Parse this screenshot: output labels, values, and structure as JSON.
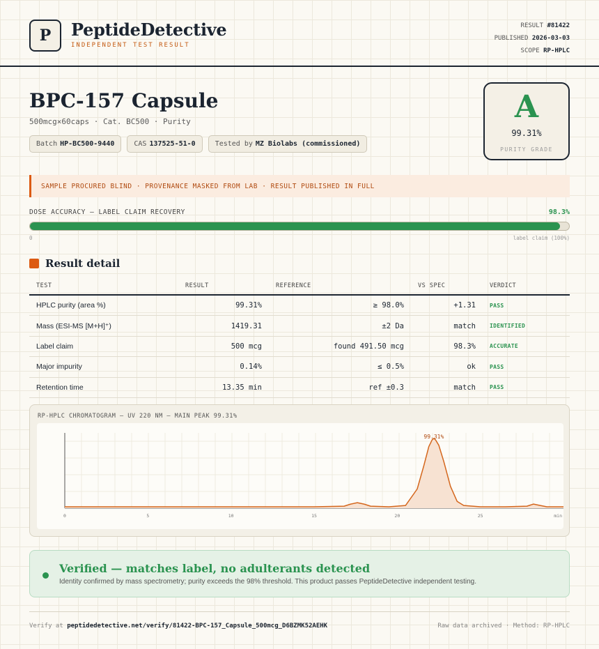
{
  "header": {
    "logo_letter": "P",
    "brand": "PeptideDetective",
    "tagline": "INDEPENDENT TEST RESULT",
    "result_label": "RESULT",
    "result_value": "#81422",
    "published_label": "PUBLISHED",
    "published_value": "2026-03-03",
    "scope_label": "SCOPE",
    "scope_value": "RP-HPLC"
  },
  "product": {
    "title": "BPC-157 Capsule",
    "subtitle": "500mcg×60caps · Cat. BC500 · Purity",
    "chips": [
      {
        "label": "Batch",
        "value": "HP-BC500-9440"
      },
      {
        "label": "CAS",
        "value": "137525-51-0"
      },
      {
        "label": "Tested by",
        "value": "MZ Biolabs (commissioned)"
      }
    ]
  },
  "grade": {
    "letter": "A",
    "percent": "99.31%",
    "label": "PURITY GRADE",
    "color": "#2b9350"
  },
  "notice": "SAMPLE PROCURED BLIND · PROVENANCE MASKED FROM LAB · RESULT PUBLISHED IN FULL",
  "dose": {
    "label": "DOSE ACCURACY — LABEL CLAIM RECOVERY",
    "value": "98.3%",
    "fraction": 0.983,
    "min_label": "0",
    "max_label": "label claim (100%)"
  },
  "section_title": "Result detail",
  "table": {
    "headers": {
      "test": "TEST",
      "result": "RESULT",
      "reference": "REFERENCE",
      "vs_spec": "VS SPEC",
      "verdict": "VERDICT"
    },
    "rows": [
      {
        "test": "HPLC purity (area %)",
        "result": "99.31%",
        "reference": "≥ 98.0%",
        "vs_spec": "+1.31",
        "verdict": "PASS"
      },
      {
        "test": "Mass (ESI-MS [M+H]⁺)",
        "result": "1419.31",
        "reference": "±2 Da",
        "vs_spec": "match",
        "verdict": "IDENTIFIED"
      },
      {
        "test": "Label claim",
        "result": "500 mcg",
        "reference": "found 491.50 mcg",
        "vs_spec": "98.3%",
        "verdict": "ACCURATE"
      },
      {
        "test": "Major impurity",
        "result": "0.14%",
        "reference": "≤ 0.5%",
        "vs_spec": "ok",
        "verdict": "PASS"
      },
      {
        "test": "Retention time",
        "result": "13.35 min",
        "reference": "ref ±0.3",
        "vs_spec": "match",
        "verdict": "PASS"
      }
    ]
  },
  "chart_data": {
    "type": "line",
    "title": "RP-HPLC CHROMATOGRAM — UV 220 NM — MAIN PEAK 99.31%",
    "xlabel": "min",
    "ylabel": "",
    "xlim": [
      0,
      30
    ],
    "ylim": [
      0,
      1.1
    ],
    "x_ticks": [
      0,
      5,
      10,
      15,
      20,
      25
    ],
    "grid": true,
    "peak_label": "99.31%",
    "peak_label_x": 22.2,
    "color": "#d4661c",
    "fill": "#f7e2d2",
    "series": [
      {
        "x": [
          0,
          5,
          10,
          15,
          16.8,
          17.2,
          17.6,
          18.0,
          18.4,
          19.5,
          20.5,
          21.2,
          21.6,
          21.9,
          22.1,
          22.2,
          22.3,
          22.5,
          22.8,
          23.2,
          23.6,
          24.0,
          25,
          26.5,
          27.8,
          28.2,
          28.6,
          29.0,
          30
        ],
        "y": [
          0.02,
          0.02,
          0.02,
          0.02,
          0.03,
          0.06,
          0.08,
          0.06,
          0.03,
          0.02,
          0.04,
          0.28,
          0.62,
          0.9,
          1.0,
          1.02,
          1.0,
          0.92,
          0.68,
          0.32,
          0.1,
          0.04,
          0.02,
          0.02,
          0.03,
          0.06,
          0.04,
          0.02,
          0.02
        ]
      }
    ]
  },
  "verified": {
    "title": "Verified — matches label, no adulterants detected",
    "subtitle": "Identity confirmed by mass spectrometry; purity exceeds the 98% threshold. This product passes PeptideDetective independent testing."
  },
  "footer": {
    "verify_prefix": "Verify at",
    "verify_url": "peptidedetective.net/verify/81422-BPC-157_Capsule_500mcg_D6BZMK52AEHK",
    "right": "Raw data archived · Method: RP-HPLC"
  }
}
